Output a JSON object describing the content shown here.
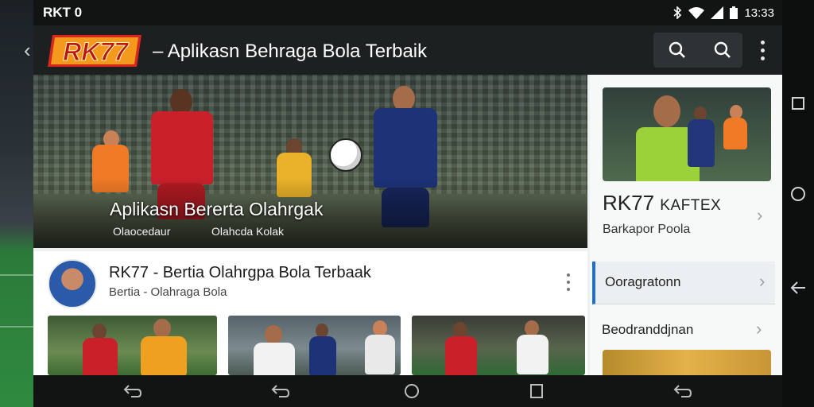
{
  "status_bar": {
    "carrier": "RKT 0",
    "time": "13:33",
    "icons": [
      "bluetooth-icon",
      "wifi-icon",
      "signal-icon",
      "battery-icon"
    ]
  },
  "app_bar": {
    "logo_text": "RK77",
    "title": "– Aplikasn Behraga Bola Terbaik",
    "icons": [
      "back-icon",
      "search-icon",
      "search-icon",
      "more-vert-icon"
    ]
  },
  "hero": {
    "title": "Aplikasn Bererta Olahrgak",
    "meta_left": "Olaocedaur",
    "meta_right": "Olahcda Kolak"
  },
  "side_panel": {
    "title": "RK77",
    "title_suffix": "KAFTEX",
    "subtitle": "Barkapor Poola",
    "items": [
      {
        "label": "Ooragratonn",
        "active": true
      },
      {
        "label": "Beodranddjnan",
        "active": false
      }
    ]
  },
  "article": {
    "title": "RK77 - Bertia Olahrgpa Bola Terbaak",
    "subtitle": "Bertia - Olahraga Bola"
  },
  "colors": {
    "accent": "#1e6fd0",
    "app_bar": "#1d2021",
    "logo_orange": "#f39a1c",
    "logo_red": "#d8261f"
  },
  "nav_bar": {
    "bottom_icons": [
      "back-icon",
      "back-icon",
      "home-icon",
      "recents-icon",
      "back-icon"
    ],
    "right_icons": [
      "recents-icon",
      "home-icon",
      "back-icon"
    ]
  }
}
